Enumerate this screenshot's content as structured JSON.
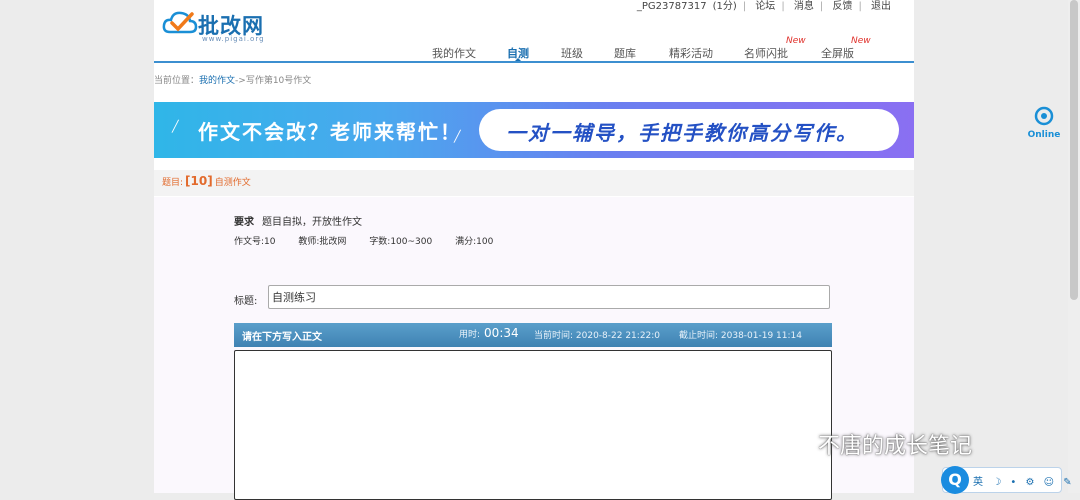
{
  "header": {
    "logo_name": "批改网",
    "logo_url": "www.pigai.org",
    "user": "_PG23787317",
    "user_score": "(1分)",
    "links": [
      "论坛",
      "消息",
      "反馈",
      "退出"
    ]
  },
  "nav": {
    "items": [
      "我的作文",
      "自测",
      "班级",
      "题库",
      "精彩活动",
      "名师闪批",
      "全屏版"
    ],
    "active_index": 1,
    "new_badge": "New"
  },
  "breadcrumb": {
    "prefix": "当前位置：",
    "link": "我的作文",
    "rest": "->写作第10号作文"
  },
  "banner": {
    "left_text": "作文不会改？老师来帮忙！",
    "right_text": "一对一辅导，手把手教你高分写作。"
  },
  "topic": {
    "label": "题目:",
    "number": "[10]",
    "name": "自测作文"
  },
  "requirement": {
    "label": "要求",
    "text": "题目自拟，开放性作文"
  },
  "meta": {
    "essay_no": "作文号:10",
    "teacher": "教师:批改网",
    "words": "字数:100~300",
    "full_score": "满分:100"
  },
  "title_field": {
    "label": "标题:",
    "value": "自测练习"
  },
  "editor": {
    "header": "请在下方写入正文",
    "used_label": "用时:",
    "used_value": "00:34",
    "now": "当前时间: 2020-8-22 21:22:0",
    "deadline": "截止时间: 2038-01-19 11:14"
  },
  "online": {
    "label": "Online"
  },
  "watermark": "不唐的成长笔记",
  "ime": {
    "logo": "Q",
    "items": [
      "英",
      "☽",
      "•",
      "⚙",
      "☺",
      "✎"
    ]
  },
  "colors": {
    "brand_blue": "#1a6fb0",
    "nav_line": "#3c8fd0",
    "topic_orange": "#e26a2c",
    "new_red": "#e0312b",
    "editor_head": "#4a8fbf"
  }
}
